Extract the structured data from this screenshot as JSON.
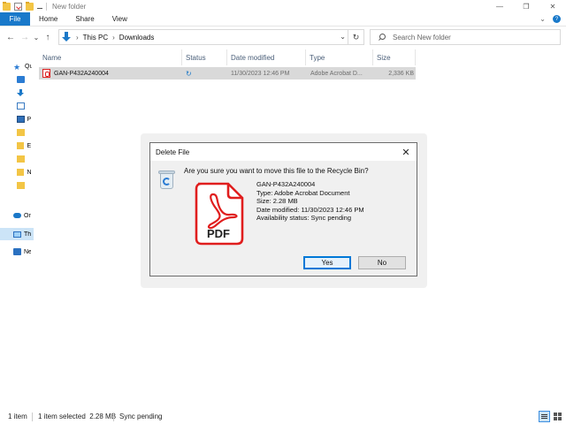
{
  "window": {
    "title": "New folder",
    "controls": {
      "minimize": "—",
      "maximize": "❐",
      "close": "✕"
    }
  },
  "ribbon": {
    "tabs": [
      "File",
      "Home",
      "Share",
      "View"
    ],
    "expand": "⌄",
    "help": "?"
  },
  "address_bar": {
    "path": [
      "This PC",
      "Downloads"
    ],
    "separator": "›",
    "back": "←",
    "forward": "→",
    "recent": "⌄",
    "up": "↑",
    "dropdown": "⌄",
    "refresh": "↻"
  },
  "search": {
    "placeholder": "Search New folder"
  },
  "nav_pane": {
    "items": [
      {
        "label": "Qu",
        "icon": "star-icon"
      },
      {
        "label": "",
        "icon": "desktop-icon"
      },
      {
        "label": "",
        "icon": "downloads-icon"
      },
      {
        "label": "",
        "icon": "documents-icon"
      },
      {
        "label": "P",
        "icon": "pictures-icon"
      },
      {
        "label": "",
        "icon": "folder-icon"
      },
      {
        "label": "E",
        "icon": "folder-icon"
      },
      {
        "label": "",
        "icon": "folder-icon"
      },
      {
        "label": "N",
        "icon": "folder-icon"
      },
      {
        "label": "",
        "icon": "folder-icon"
      },
      {
        "label": "On",
        "icon": "onedrive-icon"
      },
      {
        "label": "Thi",
        "icon": "this-pc-icon"
      },
      {
        "label": "Ne",
        "icon": "network-icon"
      }
    ]
  },
  "file_list": {
    "columns": [
      "Name",
      "Status",
      "Date modified",
      "Type",
      "Size"
    ],
    "rows": [
      {
        "name": "GAN-P432A240004",
        "status": "↻",
        "date_modified": "11/30/2023 12:46 PM",
        "type": "Adobe Acrobat D...",
        "size": "2,336 KB"
      }
    ]
  },
  "dialog": {
    "title": "Delete File",
    "close": "✕",
    "question": "Are you sure you want to move this file to the Recycle Bin?",
    "file_name": "GAN-P432A240004",
    "file_type": "Type: Adobe Acrobat Document",
    "file_size": "Size: 2.28 MB",
    "file_date": "Date modified: 11/30/2023 12:46 PM",
    "file_availability": "Availability status: Sync pending",
    "pdf_label": "PDF",
    "yes_label": "Yes",
    "no_label": "No"
  },
  "status_bar": {
    "items_count": "1 item",
    "selected": "1 item selected  2.28 MB",
    "sync": "Sync pending"
  },
  "colors": {
    "file_tab": "#1979ca",
    "selected_row": "#d9d9d9",
    "pdf_red": "#e01e1e",
    "primary_button_border": "#0078d7"
  }
}
